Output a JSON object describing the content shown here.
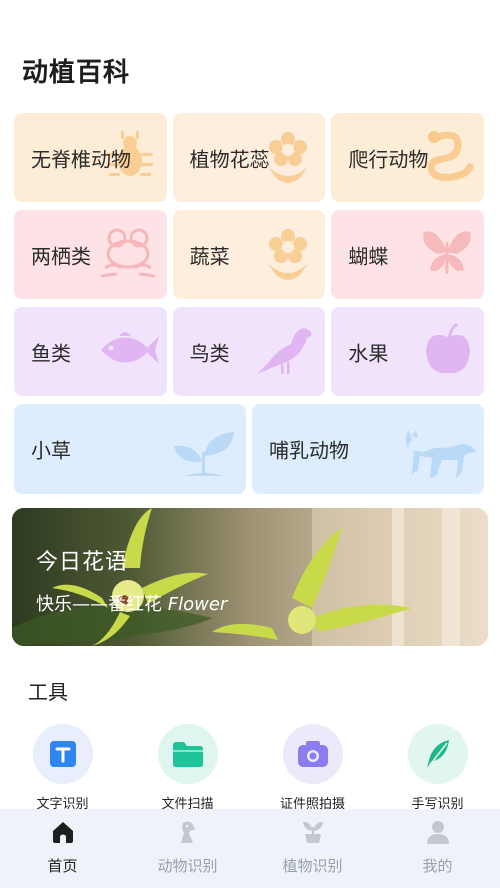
{
  "page_title": "动植百科",
  "categories": [
    {
      "label": "无脊椎动物",
      "icon": "insect-icon"
    },
    {
      "label": "植物花蕊",
      "icon": "flower-icon"
    },
    {
      "label": "爬行动物",
      "icon": "snake-icon"
    },
    {
      "label": "两栖类",
      "icon": "frog-icon"
    },
    {
      "label": "蔬菜",
      "icon": "flower-icon"
    },
    {
      "label": "蝴蝶",
      "icon": "butterfly-icon"
    },
    {
      "label": "鱼类",
      "icon": "fish-icon"
    },
    {
      "label": "鸟类",
      "icon": "bird-icon"
    },
    {
      "label": "水果",
      "icon": "apple-icon"
    },
    {
      "label": "小草",
      "icon": "sprout-icon"
    },
    {
      "label": "哺乳动物",
      "icon": "fox-icon"
    }
  ],
  "banner": {
    "title": "今日花语",
    "subtitle": "快乐——番红花",
    "subtitle_en": "Flower"
  },
  "tools": {
    "title": "工具",
    "items": [
      {
        "label": "文字识别",
        "icon": "text-recognition-icon"
      },
      {
        "label": "文件扫描",
        "icon": "folder-icon"
      },
      {
        "label": "证件照拍摄",
        "icon": "camera-icon"
      },
      {
        "label": "手写识别",
        "icon": "feather-icon"
      }
    ]
  },
  "tabbar": [
    {
      "label": "首页",
      "icon": "home-icon",
      "active": true
    },
    {
      "label": "动物识别",
      "icon": "animal-icon",
      "active": false
    },
    {
      "label": "植物识别",
      "icon": "plant-icon",
      "active": false
    },
    {
      "label": "我的",
      "icon": "user-icon",
      "active": false
    }
  ]
}
